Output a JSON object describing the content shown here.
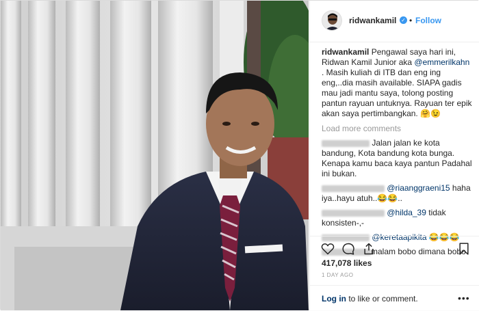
{
  "post": {
    "username": "ridwankamil",
    "dot": "•",
    "follow_label": "Follow",
    "caption_user": "ridwankamil",
    "caption_text_1": " Pengawal saya hari ini, Ridwan Kamil Junior aka ",
    "caption_mention": "@emmerilkahn",
    "caption_text_2": " . Masih kuliah di ITB dan eng ing eng,..dia masih available. SIAPA gadis mau jadi mantu saya, tolong posting pantun rayuan untuknya. Rayuan ter epik akan saya pertimbangkan. 🤗😉",
    "load_more": "Load more comments",
    "likes": "417,078 likes",
    "time_ago": "1 DAY AGO",
    "login_link": "Log in",
    "login_rest": " to like or comment.",
    "more_options": "•••"
  },
  "comments": [
    {
      "text": " Jalan jalan ke kota bandung, Kota bandung kota bunga. Kenapa kamu baca kaya pantun Padahal ini bukan.",
      "mention": ""
    },
    {
      "text": " haha iya..hayu atuh..😂😂..",
      "mention": "@riaanggraeni15"
    },
    {
      "text": " tidak konsisten-,-",
      "mention": "@hilda_39"
    },
    {
      "text": " 😂😂😂",
      "mention": "@keretaapikita"
    },
    {
      "text": "malam bobo dimana bobo",
      "mention": ""
    }
  ],
  "colors": {
    "link": "#3897f0",
    "mention": "#003569",
    "muted": "#999999"
  },
  "icons": [
    "heart-icon",
    "comment-icon",
    "share-icon",
    "bookmark-icon",
    "verified-badge-icon"
  ]
}
